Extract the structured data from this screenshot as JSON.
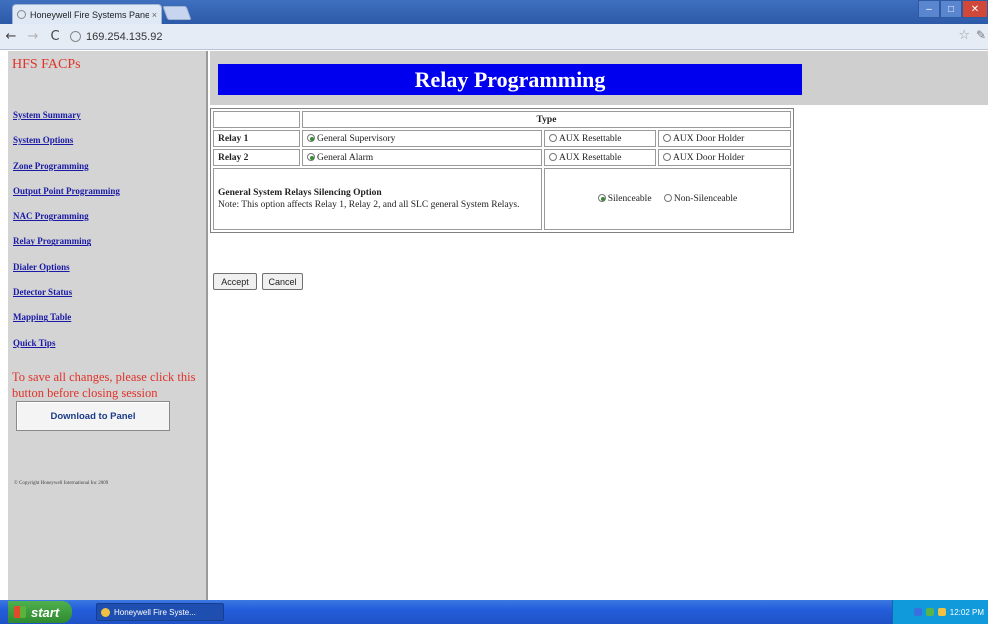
{
  "browser": {
    "tab_title": "Honeywell Fire Systems Panel",
    "tab_close": "×",
    "url": "169.254.135.92",
    "back": "←",
    "forward": "→",
    "reload": "C",
    "star": "☆",
    "wrench": "✎",
    "min": "–",
    "max": "□",
    "close": "✕"
  },
  "sidebar": {
    "brand": "HFS FACPs",
    "items": [
      {
        "label": "System Summary"
      },
      {
        "label": "System Options"
      },
      {
        "label": "Zone Programming"
      },
      {
        "label": "Output Point Programming"
      },
      {
        "label": "NAC Programming"
      },
      {
        "label": "Relay Programming"
      },
      {
        "label": "Dialer Options"
      },
      {
        "label": "Detector Status"
      },
      {
        "label": "Mapping Table"
      },
      {
        "label": "Quick Tips"
      }
    ],
    "save_note": "To save all changes, please click this button before closing session",
    "download_label": "Download to Panel",
    "copyright": "© Copyright Honeywell International Inc 2009"
  },
  "main": {
    "title": "Relay Programming",
    "type_header": "Type",
    "relays": [
      {
        "label": "Relay 1",
        "opt1": "General Supervisory",
        "opt2": "AUX Resettable",
        "opt3": "AUX Door Holder",
        "selected": 1
      },
      {
        "label": "Relay 2",
        "opt1": "General Alarm",
        "opt2": "AUX Resettable",
        "opt3": "AUX Door Holder",
        "selected": 1
      }
    ],
    "silencing": {
      "title": "General System Relays Silencing Option",
      "note": "Note: This option affects Relay 1, Relay 2, and all SLC general System Relays.",
      "opt1": "Silenceable",
      "opt2": "Non-Silenceable",
      "selected": 1
    },
    "accept_label": "Accept",
    "cancel_label": "Cancel"
  },
  "taskbar": {
    "start_label": "start",
    "task_label": "Honeywell Fire Syste...",
    "clock": "12:02 PM"
  }
}
